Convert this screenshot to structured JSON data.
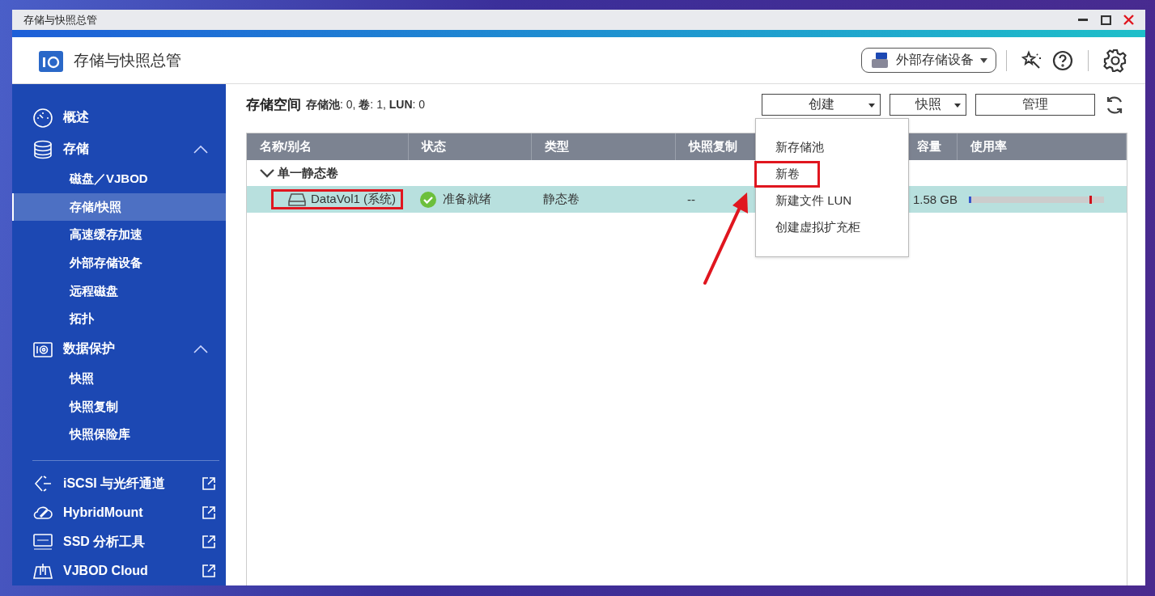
{
  "window": {
    "title": "存储与快照总管"
  },
  "header": {
    "app_name": "存储与快照总管",
    "device_button": "外部存储设备"
  },
  "sidebar": {
    "sections": [
      {
        "label": "概述",
        "kind": "overview"
      },
      {
        "label": "存储",
        "kind": "storage",
        "expanded": true,
        "children": [
          {
            "label": "磁盘／VJBOD",
            "selected": false
          },
          {
            "label": "存储/快照",
            "selected": true
          },
          {
            "label": "高速缓存加速",
            "selected": false
          },
          {
            "label": "外部存储设备",
            "selected": false
          },
          {
            "label": "远程磁盘",
            "selected": false
          },
          {
            "label": "拓扑",
            "selected": false
          }
        ]
      },
      {
        "label": "数据保护",
        "kind": "protection",
        "expanded": true,
        "children": [
          {
            "label": "快照",
            "selected": false
          },
          {
            "label": "快照复制",
            "selected": false
          },
          {
            "label": "快照保险库",
            "selected": false
          }
        ]
      }
    ],
    "links": [
      {
        "label": "iSCSI 与光纤通道",
        "kind": "iscsi"
      },
      {
        "label": "HybridMount",
        "kind": "cloud"
      },
      {
        "label": "SSD 分析工具",
        "kind": "ssd"
      },
      {
        "label": "VJBOD Cloud",
        "kind": "vjbod"
      }
    ]
  },
  "toolbar": {
    "title": "存储空间",
    "summary": "**存储池**: 0, **卷**: 1, **LUN**: 0",
    "buttons": [
      {
        "label": "创建",
        "dropdown": true
      },
      {
        "label": "快照",
        "dropdown": true
      },
      {
        "label": "管理",
        "dropdown": false
      }
    ]
  },
  "menu": {
    "open": true,
    "items": [
      {
        "label": "新存储池",
        "highlighted": false
      },
      {
        "label": "新卷",
        "highlighted": true
      },
      {
        "label": "新建文件 LUN",
        "highlighted": false
      },
      {
        "label": "创建虚拟扩充柜",
        "highlighted": false
      }
    ]
  },
  "table": {
    "columns": [
      "名称/别名",
      "状态",
      "类型",
      "快照复制",
      "容量",
      "使用率"
    ],
    "groups": [
      {
        "label": "单一静态卷",
        "expanded": true,
        "rows": [
          {
            "name": "DataVol1 (系统)",
            "name_highlighted": true,
            "status": "准备就绪",
            "type": "静态卷",
            "snapshot_replication": "--",
            "capacity": "1.58 GB",
            "level": 0.02,
            "selected": true
          }
        ]
      }
    ]
  }
}
